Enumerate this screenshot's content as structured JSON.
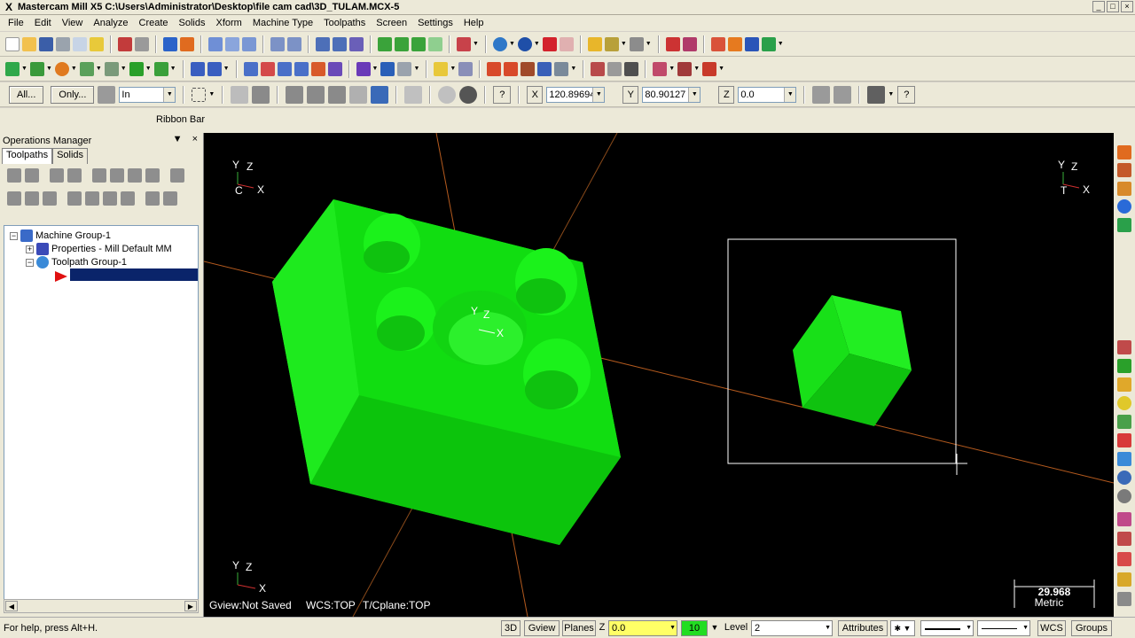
{
  "window": {
    "title": "Mastercam Mill X5  C:\\Users\\Administrator\\Desktop\\file cam cad\\3D_TULAM.MCX-5",
    "app_icon": "X",
    "min_glyph": "_",
    "max_glyph": "□",
    "close_glyph": "×"
  },
  "menu": [
    "File",
    "Edit",
    "View",
    "Analyze",
    "Create",
    "Solids",
    "Xform",
    "Machine Type",
    "Toolpaths",
    "Screen",
    "Settings",
    "Help"
  ],
  "general_toolbar": {
    "all_label": "All...",
    "only_label": "Only...",
    "mode_value": "In",
    "x_label": "X",
    "x_value": "120.89694",
    "y_label": "Y",
    "y_value": "80.90127",
    "z_label": "Z",
    "z_value": "0.0",
    "help_glyph": "?"
  },
  "ribbon": {
    "label": "Ribbon Bar"
  },
  "operations_manager": {
    "title": "Operations Manager",
    "pin_glyph": "▼",
    "close_glyph": "×",
    "tabs": [
      "Toolpaths",
      "Solids"
    ],
    "tree": {
      "machine_group": "Machine Group-1",
      "properties": "Properties - Mill Default MM",
      "toolpath_group": "Toolpath Group-1"
    },
    "expand_glyph": "+",
    "collapse_glyph": "−"
  },
  "viewport": {
    "gview": "Gview:Not Saved",
    "wcs": "WCS:TOP",
    "cplane": "T/Cplane:TOP",
    "scale_value": "29.968",
    "scale_unit": "Metric",
    "axis_x": "X",
    "axis_y": "Y",
    "axis_z": "Z",
    "corner_c": "C",
    "corner_t": "T",
    "colors": {
      "part": "#11e811",
      "part_dark": "#0bb00b",
      "part_light": "#3df03d",
      "axis_line": "#b45a1e",
      "background": "#000000"
    }
  },
  "status_bar": {
    "help_text": "For help, press Alt+H.",
    "btn_3d": "3D",
    "btn_gview": "Gview",
    "btn_planes": "Planes",
    "z_label": "Z",
    "z_value": "0.0",
    "color_value": "10",
    "level_label": "Level",
    "level_value": "2",
    "attributes": "Attributes",
    "wcs": "WCS",
    "groups": "Groups"
  }
}
